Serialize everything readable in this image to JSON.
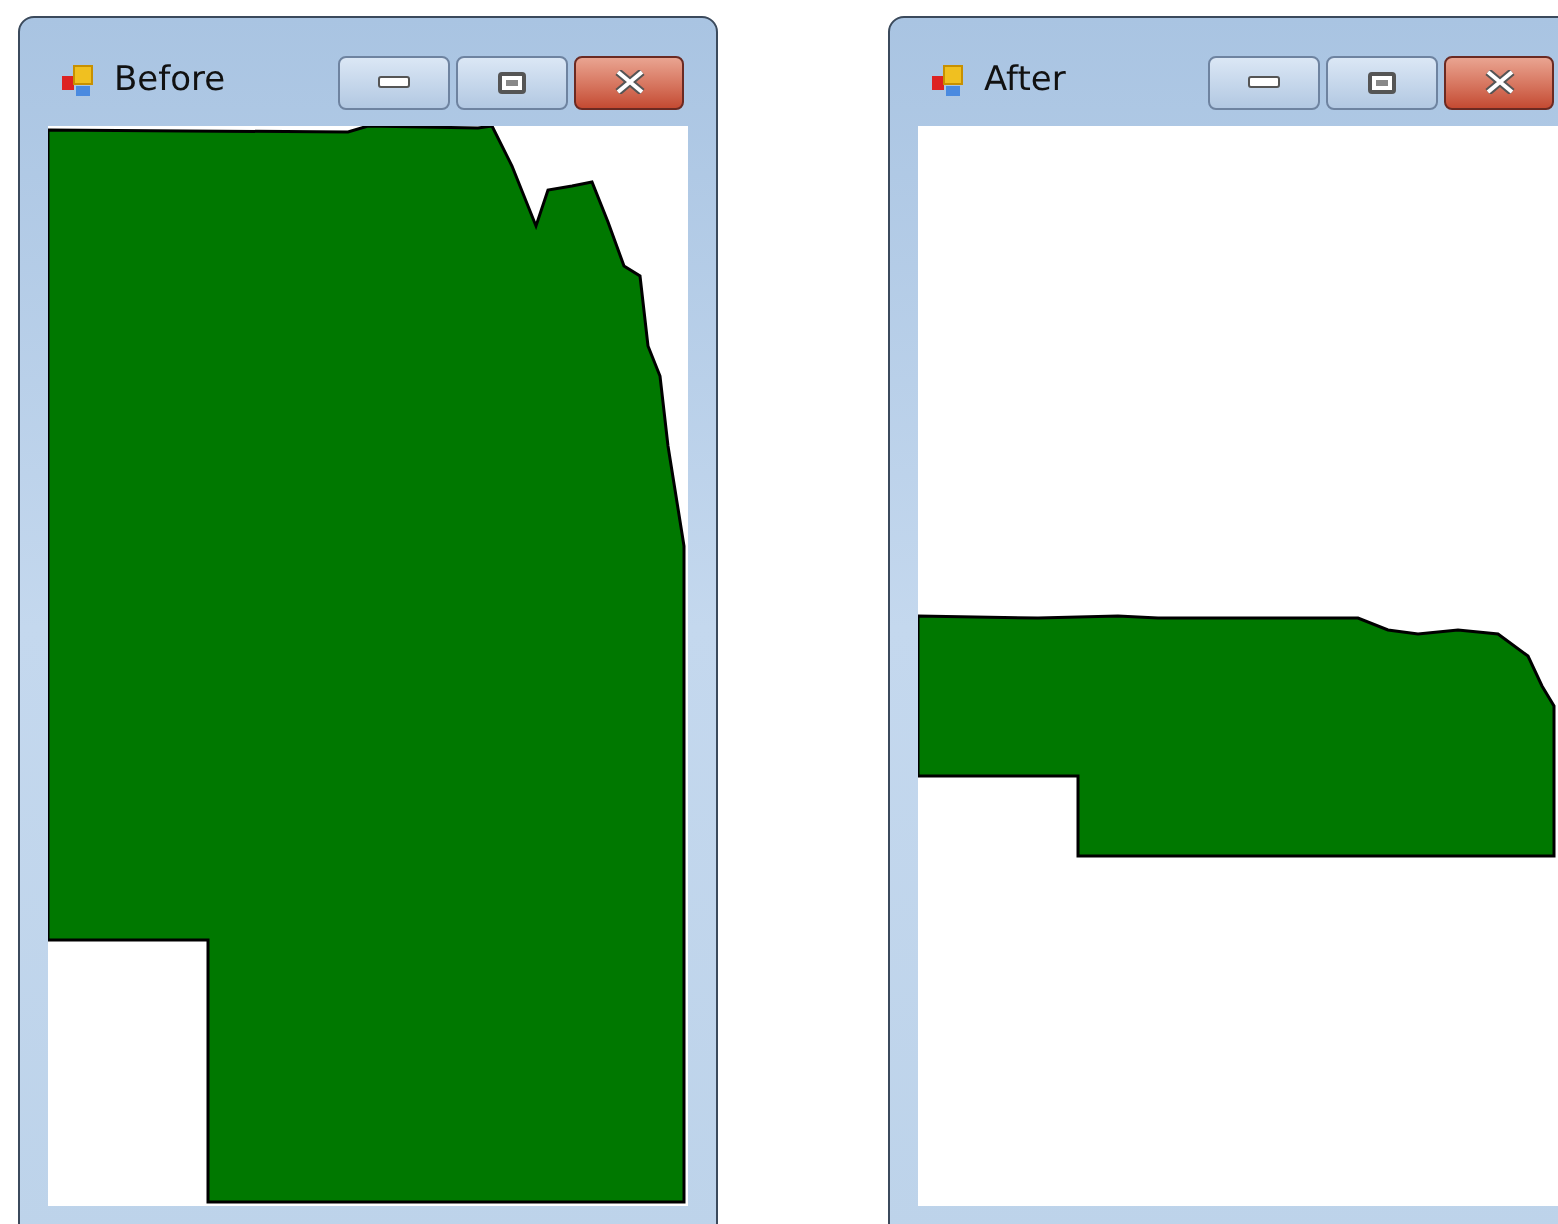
{
  "windows": [
    {
      "title": "Before",
      "kind": "before"
    },
    {
      "title": "After",
      "kind": "after"
    }
  ]
}
